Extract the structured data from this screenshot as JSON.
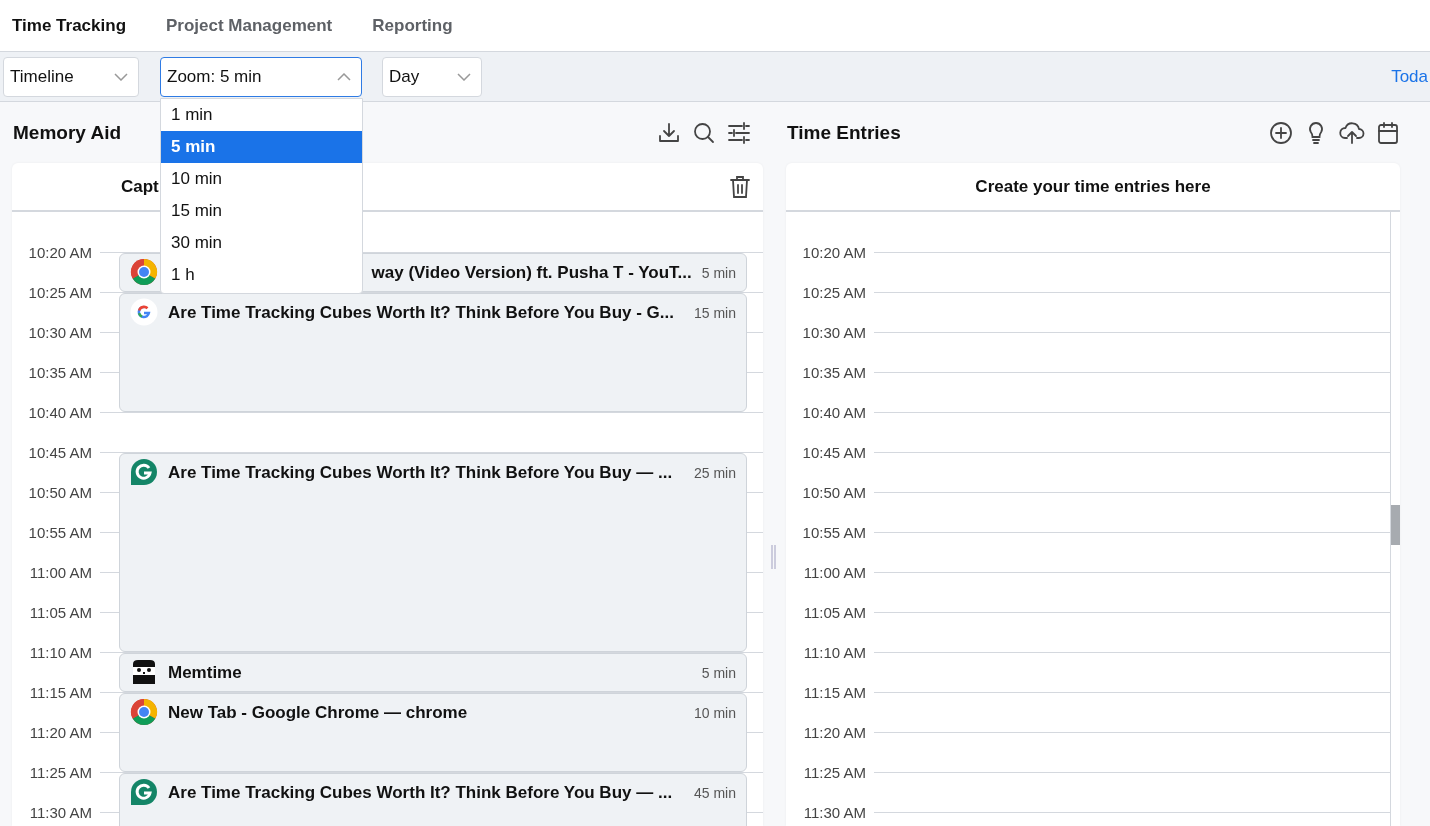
{
  "tabs": [
    {
      "label": "Time Tracking",
      "selected": true
    },
    {
      "label": "Project Management",
      "selected": false
    },
    {
      "label": "Reporting",
      "selected": false
    }
  ],
  "toolbar": {
    "view_select": "Timeline",
    "zoom_select": "Zoom: 5 min",
    "zoom_open": true,
    "range_select": "Day",
    "today_link": "Toda"
  },
  "zoom_menu": [
    {
      "label": "1 min",
      "selected": false
    },
    {
      "label": "5 min",
      "selected": true
    },
    {
      "label": "10 min",
      "selected": false
    },
    {
      "label": "15 min",
      "selected": false
    },
    {
      "label": "30 min",
      "selected": false
    },
    {
      "label": "1 h",
      "selected": false
    }
  ],
  "memory_aid": {
    "title": "Memory Aid",
    "card_header": "Capt",
    "rows": [
      {
        "time": "10:20 AM",
        "entries": [
          {
            "kind": "chrome",
            "title": "way (Video Version) ft. Pusha T - YouT...",
            "duration": "5 min",
            "partly_covered": true
          }
        ]
      },
      {
        "time": "10:25 AM",
        "entries": [
          {
            "kind": "google",
            "title": "Are Time Tracking Cubes Worth It? Think Before You Buy - G...",
            "duration": "15 min",
            "partly_covered": false
          }
        ]
      },
      {
        "time": "10:30 AM"
      },
      {
        "time": "10:35 AM"
      },
      {
        "time": "10:40 AM"
      },
      {
        "time": "10:45 AM",
        "entries": [
          {
            "kind": "grammarly",
            "title": "Are Time Tracking Cubes Worth It? Think Before You Buy — ...",
            "duration": "25 min",
            "partly_covered": false
          }
        ]
      },
      {
        "time": "10:50 AM"
      },
      {
        "time": "10:55 AM"
      },
      {
        "time": "11:00 AM"
      },
      {
        "time": "11:05 AM"
      },
      {
        "time": "11:10 AM",
        "entries": [
          {
            "kind": "memtime",
            "title": "Memtime",
            "duration": "5 min",
            "partly_covered": false
          }
        ]
      },
      {
        "time": "11:15 AM",
        "entries": [
          {
            "kind": "chrome",
            "title": "New Tab - Google Chrome — chrome",
            "duration": "10 min",
            "partly_covered": false
          }
        ]
      },
      {
        "time": "11:20 AM"
      },
      {
        "time": "11:25 AM",
        "entries": [
          {
            "kind": "grammarly",
            "title": "Are Time Tracking Cubes Worth It? Think Before You Buy — ...",
            "duration": "45 min",
            "partly_covered": false
          }
        ]
      },
      {
        "time": "11:30 AM"
      }
    ]
  },
  "time_entries": {
    "title": "Time Entries",
    "card_header": "Create your time entries here",
    "rows": [
      "10:20 AM",
      "10:25 AM",
      "10:30 AM",
      "10:35 AM",
      "10:40 AM",
      "10:45 AM",
      "10:50 AM",
      "10:55 AM",
      "11:00 AM",
      "11:05 AM",
      "11:10 AM",
      "11:15 AM",
      "11:20 AM",
      "11:25 AM",
      "11:30 AM"
    ]
  }
}
